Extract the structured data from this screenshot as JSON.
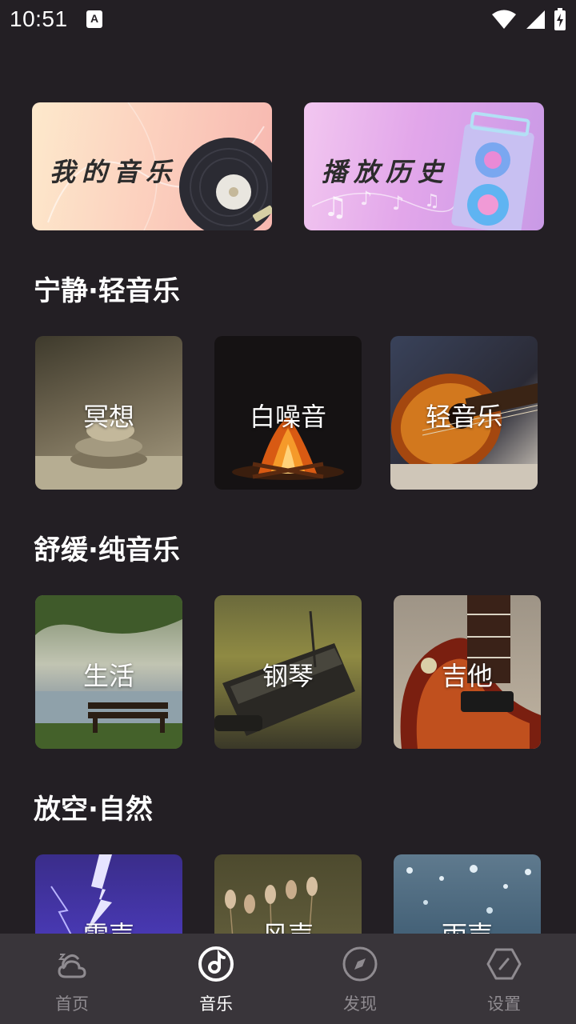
{
  "status_bar": {
    "time": "10:51",
    "notification_icon": "A"
  },
  "features": [
    {
      "label": "我的音乐",
      "icon": "vinyl-record-icon"
    },
    {
      "label": "播放历史",
      "icon": "speaker-icon"
    }
  ],
  "sections": [
    {
      "title": "宁静·轻音乐",
      "tiles": [
        "冥想",
        "白噪音",
        "轻音乐"
      ]
    },
    {
      "title": "舒缓·纯音乐",
      "tiles": [
        "生活",
        "钢琴",
        "吉他"
      ]
    },
    {
      "title": "放空·自然",
      "tiles": [
        "雷声",
        "风声",
        "雨声"
      ]
    }
  ],
  "bottom_nav": [
    {
      "label": "首页",
      "icon": "home-weather-icon",
      "active": false
    },
    {
      "label": "音乐",
      "icon": "music-note-icon",
      "active": true
    },
    {
      "label": "发现",
      "icon": "compass-icon",
      "active": false
    },
    {
      "label": "设置",
      "icon": "settings-hexagon-icon",
      "active": false
    }
  ],
  "colors": {
    "background": "#231f24",
    "nav_background": "#39353a",
    "nav_inactive": "#8f8b90",
    "nav_active": "#ffffff"
  }
}
